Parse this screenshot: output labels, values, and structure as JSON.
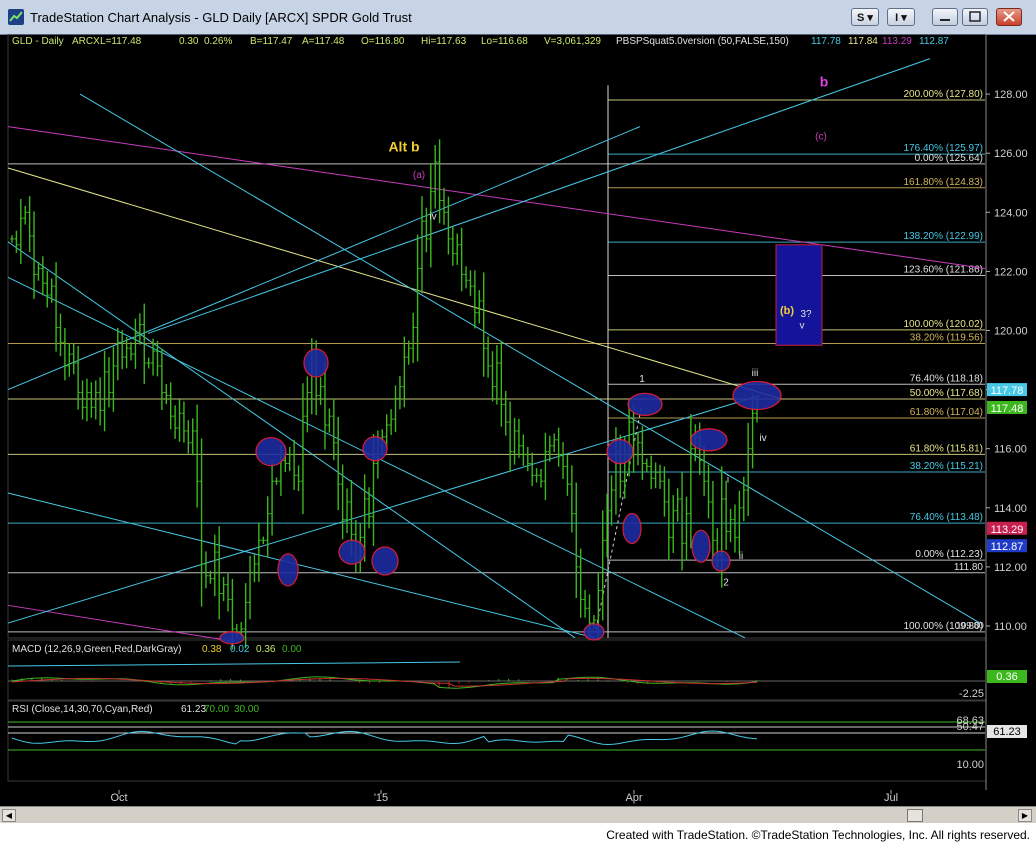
{
  "window": {
    "title": "TradeStation Chart Analysis - GLD Daily [ARCX] SPDR Gold Trust",
    "s_button": "S",
    "i_button": "I"
  },
  "footer": {
    "text": "Created with TradeStation. ©TradeStation Technologies, Inc. All rights reserved."
  },
  "colors": {
    "background": "#000000",
    "bars": "#3cb81e",
    "cyan": "#46c8e6",
    "magenta": "#c83cbe",
    "yellow": "#e6e68c",
    "ellipse_fill": "#1e2ca0",
    "ellipse_stroke": "#e61e3c",
    "box_fill": "#14149a",
    "box_stroke": "#c81e3c"
  },
  "header": {
    "symbol": "GLD - Daily",
    "exchange": "ARCX",
    "last": "L=117.48",
    "change": "0.30",
    "change_pct": "0.26%",
    "bid": "B=117.47",
    "ask": "A=117.48",
    "open": "O=116.80",
    "high": "Hi=117.63",
    "low": "Lo=116.68",
    "volume": "V=3,061,329",
    "study": "PBSPSquat5.0version (50,FALSE,150)",
    "study_values": [
      "117.78",
      "117.84",
      "113.29",
      "112.87"
    ]
  },
  "chart_data": [
    {
      "type": "ohlc",
      "title": "GLD Daily [ARCX] SPDR Gold Trust",
      "x_labels": [
        "Oct",
        "'15",
        "Apr",
        "Jul"
      ],
      "ylim": [
        109.6,
        129.0
      ],
      "y_ticks": [
        "110.00",
        "112.00",
        "114.00",
        "116.00",
        "118.00",
        "120.00",
        "122.00",
        "124.00",
        "126.00",
        "128.00"
      ],
      "series": [
        {
          "values": [
            123.1,
            122.9,
            123.8,
            124.0,
            123.2,
            121.9,
            122.1,
            121.6,
            121.2,
            121.5,
            120.1,
            119.6,
            118.8,
            119.2,
            118.9,
            117.9,
            117.4,
            117.9,
            117.4,
            117.9,
            117.3,
            118.6,
            117.9,
            118.8,
            119.6,
            119.1,
            119.4,
            119.2,
            119.9,
            120.2,
            118.9,
            118.9,
            119.3,
            118.8,
            117.9,
            117.8,
            117.1,
            116.7,
            117.2,
            116.6,
            116.2,
            116.6,
            114.9,
            112.1,
            111.7,
            111.6,
            112.5,
            111.1,
            111.4,
            110.9,
            109.9,
            109.8,
            109.9,
            110.8,
            111.8,
            112.1,
            112.9,
            112.9,
            113.8,
            114.9,
            114.9,
            115.6,
            115.5,
            115.8,
            115.1,
            114.9,
            117.1,
            117.9,
            119.0,
            117.8,
            118.1,
            116.8,
            117.1,
            116.2,
            114.8,
            113.6,
            114.2,
            113.1,
            112.3,
            113.0,
            114.3,
            113.7,
            115.5,
            116.1,
            116.4,
            116.8,
            117.0,
            117.7,
            118.1,
            119.1,
            119.4,
            120.1,
            122.1,
            123.7,
            123.1,
            124.7,
            125.7,
            124.4,
            124.0,
            123.1,
            122.6,
            122.9,
            121.9,
            121.7,
            121.5,
            120.6,
            121.0,
            119.4,
            118.8,
            118.1,
            118.9,
            117.5,
            116.9,
            115.9,
            116.6,
            116.1,
            115.8,
            115.5,
            115.1,
            115.1,
            114.9,
            115.9,
            116.1,
            116.3,
            115.8,
            115.4,
            114.8,
            113.8,
            112.0,
            110.9,
            110.6,
            110.1,
            110.2,
            111.2,
            112.9,
            113.9,
            114.6,
            115.9,
            114.9,
            115.8,
            116.9,
            115.8,
            116.2,
            115.5,
            115.4,
            115.0,
            115.2,
            114.9,
            114.2,
            113.0,
            113.9,
            114.3,
            112.8,
            113.8,
            116.0,
            116.4,
            115.6,
            114.9,
            114.2,
            112.9,
            112.4,
            114.3,
            113.2,
            113.6,
            113.0,
            114.0,
            114.6,
            116.0,
            117.2,
            117.48
          ]
        }
      ],
      "fib_levels": [
        {
          "label": "200.00% (127.80)",
          "value": 127.8
        },
        {
          "label": "176.40% (125.97)",
          "value": 125.97
        },
        {
          "label": "0.00% (125.64)",
          "value": 125.64
        },
        {
          "label": "161.80% (124.83)",
          "value": 124.83
        },
        {
          "label": "138.20% (122.99)",
          "value": 122.99
        },
        {
          "label": "123.60% (121.86)",
          "value": 121.86
        },
        {
          "label": "100.00% (120.02)",
          "value": 120.02
        },
        {
          "label": "38.20% (119.56)",
          "value": 119.56
        },
        {
          "label": "76.40% (118.18)",
          "value": 118.18
        },
        {
          "label": "50.00% (117.68)",
          "value": 117.68
        },
        {
          "label": "61.80% (117.04)",
          "value": 117.04
        },
        {
          "label": "61.80% (115.81)",
          "value": 115.81
        },
        {
          "label": "38.20% (115.21)",
          "value": 115.21
        },
        {
          "label": "76.40% (113.48)",
          "value": 113.48
        },
        {
          "label": "0.00% (112.23)",
          "value": 112.23
        },
        {
          "label": "111.80",
          "value": 111.8
        },
        {
          "label": "100.00% (109.80)",
          "value": 109.8
        }
      ],
      "price_tags": [
        {
          "label": "117.78",
          "value": 117.78
        },
        {
          "label": "117.48",
          "value": 117.48
        },
        {
          "label": "113.29",
          "value": 113.29
        },
        {
          "label": "112.87",
          "value": 112.87
        }
      ],
      "annotations": [
        "b",
        "(c)",
        "Alt b",
        "(a)",
        "iv",
        "(b)",
        "3?",
        "v",
        "iii",
        "1",
        "iv",
        "i",
        "ii",
        "2",
        "109.80"
      ]
    },
    {
      "type": "line",
      "title": "MACD (12,26,9,Green,Red,DarkGray)",
      "values_text": [
        "0.38",
        "0.02",
        "0.36",
        "0.00"
      ],
      "y_ticks": [
        "-2.25"
      ],
      "tag": "0.36"
    },
    {
      "type": "line",
      "title": "RSI (Close,14,30,70,Cyan,Red)",
      "values_text": [
        "61.23",
        "70.00",
        "30.00"
      ],
      "y_ticks": [
        "68.63",
        "50.47",
        "10.00"
      ],
      "tag": "61.23"
    }
  ]
}
